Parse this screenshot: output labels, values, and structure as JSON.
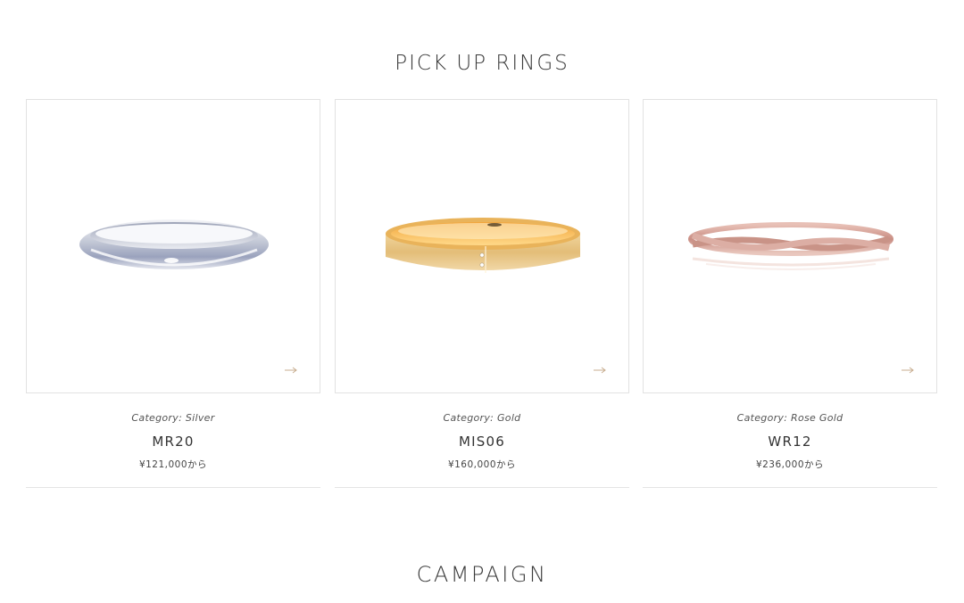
{
  "sections": {
    "pickup_title": "PICK UP RINGS",
    "campaign_title": "CAMPAIGN"
  },
  "rings": [
    {
      "category": "Category: Silver",
      "model": "MR20",
      "price": "¥121,000から",
      "icon": "silver-ring-image",
      "color": "#c9ccd6"
    },
    {
      "category": "Category: Gold",
      "model": "MIS06",
      "price": "¥160,000から",
      "icon": "gold-ring-image",
      "color": "#e6b768"
    },
    {
      "category": "Category: Rose Gold",
      "model": "WR12",
      "price": "¥236,000から",
      "icon": "rose-gold-ring-image",
      "color": "#d9a69b"
    }
  ],
  "colors": {
    "arrow": "#c8ad8f",
    "border": "#e2e2e2"
  }
}
